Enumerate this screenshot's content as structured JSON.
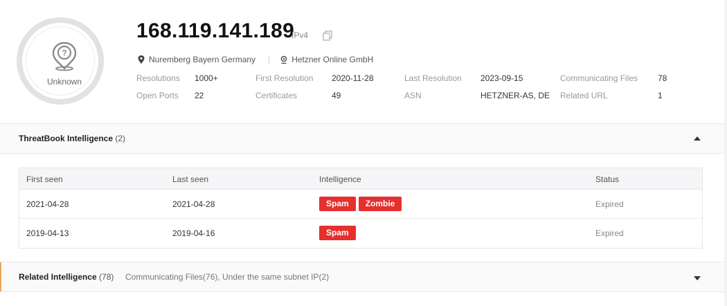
{
  "ip": {
    "address": "168.119.141.189",
    "type": "IPv4"
  },
  "badge": {
    "label": "Unknown",
    "icon": "unknown-location-icon"
  },
  "location": {
    "place": "Nuremberg Bayern Germany",
    "org": "Hetzner Online GmbH"
  },
  "stats": {
    "resolutions": {
      "label": "Resolutions",
      "value": "1000+"
    },
    "first_resolution": {
      "label": "First Resolution",
      "value": "2020-11-28"
    },
    "last_resolution": {
      "label": "Last Resolution",
      "value": "2023-09-15"
    },
    "communicating_files": {
      "label": "Communicating Files",
      "value": "78"
    },
    "open_ports": {
      "label": "Open Ports",
      "value": "22"
    },
    "certificates": {
      "label": "Certificates",
      "value": "49"
    },
    "asn": {
      "label": "ASN",
      "value": "HETZNER-AS, DE"
    },
    "related_url": {
      "label": "Related URL",
      "value": "1"
    }
  },
  "threatbook": {
    "title": "ThreatBook Intelligence",
    "count": "(2)",
    "columns": [
      "First seen",
      "Last seen",
      "Intelligence",
      "Status"
    ],
    "rows": [
      {
        "first_seen": "2021-04-28",
        "last_seen": "2021-04-28",
        "tags": [
          "Spam",
          "Zombie"
        ],
        "status": "Expired"
      },
      {
        "first_seen": "2019-04-13",
        "last_seen": "2019-04-16",
        "tags": [
          "Spam"
        ],
        "status": "Expired"
      }
    ]
  },
  "related": {
    "title": "Related Intelligence",
    "count": "(78)",
    "summary": "Communicating Files(76), Under the same subnet IP(2)"
  },
  "colors": {
    "tag_red": "#e5302f",
    "accent": "#e8a85c"
  }
}
